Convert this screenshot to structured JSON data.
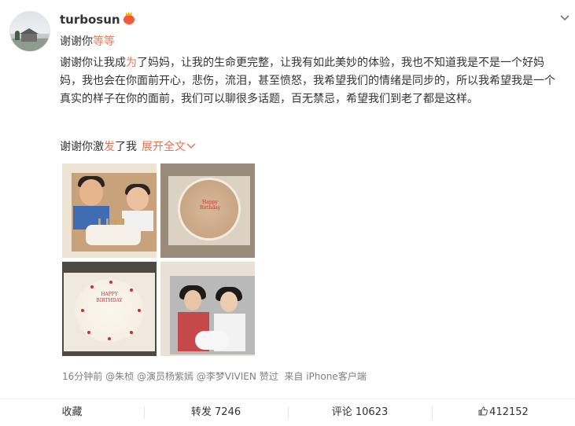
{
  "post": {
    "username": "turbosun",
    "line1_prefix": "谢谢你",
    "line1_highlight": "等等",
    "main_part1": "谢谢你让我成",
    "main_highlight": "为",
    "main_part2": "了妈妈，让我的生命更完整，让我有如此美妙的体验，我也不知道我是不是一个好妈妈，我也会在你面前开心，悲伤，流泪，甚至愤怒，我希望我们的情绪是同步的，所以我希望我是一个真实的样子在你的面前，我们可以聊很多话题，百无禁忌，希望我们到老了都是这样。",
    "last_prefix": "谢谢你激",
    "last_highlight": "发",
    "last_suffix": "了我",
    "expand_label": "展开全文",
    "expand_icon": "chevron-down-icon"
  },
  "images": {
    "cake2_text": "Happy Birthday",
    "cake3_text": "HAPPY BIRTHDAY"
  },
  "meta": {
    "time": "16分钟前",
    "mention1": "@朱桢",
    "mention2": "@演员杨紫嫣",
    "mention3": "@李梦VIVIEN",
    "liked_label": "赞过",
    "source_prefix": "来自",
    "source": "iPhone客户端"
  },
  "actions": {
    "favorite": "收藏",
    "repost": "转发 7246",
    "comment": "评论 10623",
    "like_count": "412152"
  },
  "colors": {
    "accent": "#eb7350",
    "text": "#333333",
    "meta": "#808080"
  }
}
